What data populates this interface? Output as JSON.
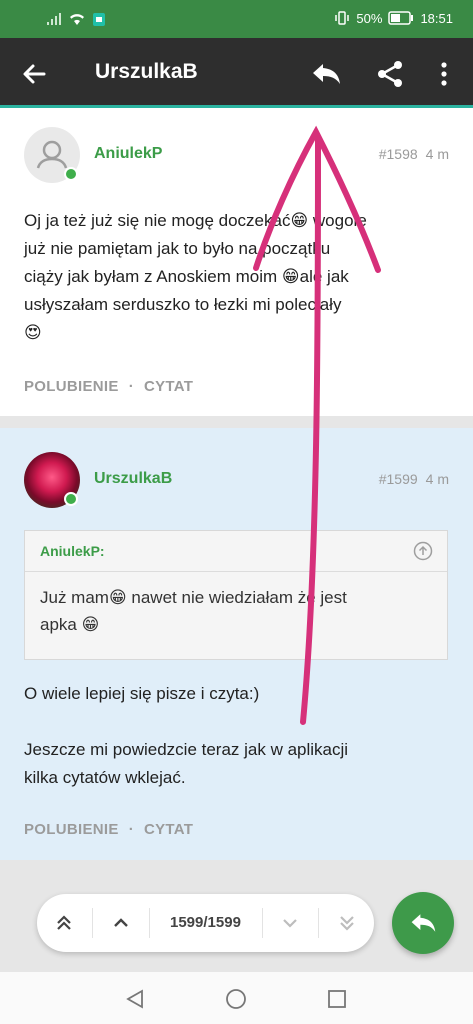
{
  "status_bar": {
    "battery": "50%",
    "time": "18:51"
  },
  "app_bar": {
    "title": "UrszulkaB",
    "icons": [
      "back-arrow-icon",
      "reply-icon",
      "share-icon",
      "more-vert-icon"
    ]
  },
  "posts": [
    {
      "author": "AniulekP",
      "number": "#1598",
      "time": "4 m",
      "lines": [
        "Oj ja też już się nie mogę doczekać😁 wogole",
        "już nie pamiętam jak to było na początku",
        "ciąży jak byłam z Anoskiem moim 😁ale jak",
        "usłyszałam serduszko to łezki mi poleciały",
        "😍"
      ],
      "like_label": "POLUBIENIE",
      "quote_label": "CYTAT"
    },
    {
      "author": "UrszulkaB",
      "number": "#1599",
      "time": "4 m",
      "quote": {
        "author": "AniulekP:",
        "line1": "Już mam😁 nawet nie wiedziałam że jest",
        "line2": "apka 😁"
      },
      "paragraphs": [
        "O wiele lepiej się pisze i czyta:)",
        "Jeszcze mi powiedzcie teraz jak w aplikacji",
        "kilka cytatów wklejać."
      ],
      "like_label": "POLUBIENIE",
      "quote_label": "CYTAT"
    }
  ],
  "pagination": {
    "current": "1599/1599"
  },
  "colors": {
    "status_bar": "#3a8a45",
    "app_bar": "#2e2e2e",
    "accent_line": "#2bb3a0",
    "author_green": "#3c9c48",
    "fab_green": "#3e9a4a",
    "highlight_post_bg": "#e0eef9",
    "annotation_pink": "#d6307a"
  }
}
